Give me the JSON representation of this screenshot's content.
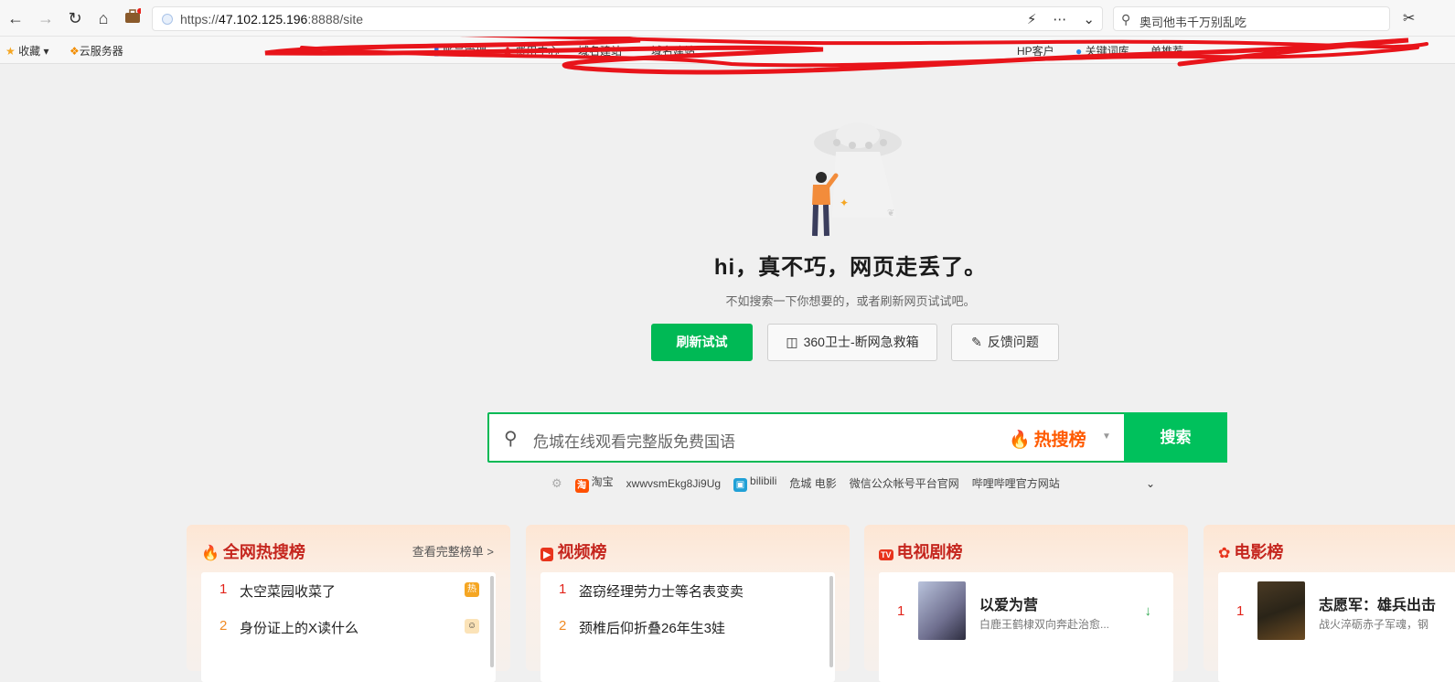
{
  "browser": {
    "url_scheme": "https://",
    "url_host": "47.102.125.196",
    "url_rest": ":8888/site",
    "search_text": "奥司他韦千万别乱吃",
    "bookmarks": [
      {
        "label": "收藏"
      },
      {
        "label": "云服务器"
      },
      {
        "label": "账号管理"
      },
      {
        "label": "费用中心"
      },
      {
        "label": "域名建站"
      },
      {
        "label": "域名建站"
      },
      {
        "label": "HP客户"
      },
      {
        "label": "关键词库"
      },
      {
        "label": "单推荐"
      }
    ]
  },
  "error": {
    "heading": "hi，真不巧，网页走丢了。",
    "subtext": "不如搜索一下你想要的，或者刷新网页试试吧。",
    "refresh_label": "刷新试试",
    "rescue_label": "360卫士-断网急救箱",
    "feedback_label": "反馈问题"
  },
  "search": {
    "placeholder": "危城在线观看完整版免费国语",
    "hot_label": "热搜榜",
    "button_label": "搜索"
  },
  "quick_links": [
    {
      "label": "淘宝",
      "icon": "taobao-icon"
    },
    {
      "label": "xwwvsmEkg8Ji9Ug",
      "icon": ""
    },
    {
      "label": "bilibili",
      "icon": "bilibili-icon"
    },
    {
      "label": "危城 电影",
      "icon": ""
    },
    {
      "label": "微信公众帐号平台官网",
      "icon": ""
    },
    {
      "label": "哔哩哔哩官方网站",
      "icon": ""
    }
  ],
  "cards": {
    "hot": {
      "title": "全网热搜榜",
      "more": "查看完整榜单 >",
      "items": [
        {
          "rank": "1",
          "text": "太空菜园收菜了",
          "badge": "热"
        },
        {
          "rank": "2",
          "text": "身份证上的X读什么",
          "badge": ""
        }
      ]
    },
    "video": {
      "title": "视频榜",
      "items": [
        {
          "rank": "1",
          "text": "盗窃经理劳力士等名表变卖"
        },
        {
          "rank": "2",
          "text": "颈椎后仰折叠26年生3娃"
        }
      ]
    },
    "tv": {
      "title": "电视剧榜",
      "items": [
        {
          "rank": "1",
          "title": "以爱为营",
          "desc": "白鹿王鹤棣双向奔赴治愈..."
        }
      ]
    },
    "movie": {
      "title": "电影榜",
      "items": [
        {
          "rank": "1",
          "title": "志愿军：雄兵出击",
          "desc": "战火淬砺赤子军魂，钢"
        }
      ]
    }
  },
  "colors": {
    "accent": "#00b955",
    "hot_red": "#c5261e"
  }
}
